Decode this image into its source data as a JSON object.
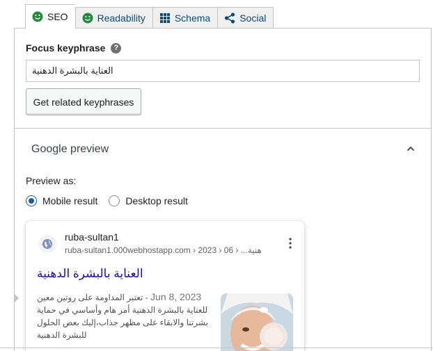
{
  "tabs": [
    {
      "label": "SEO",
      "icon": "smiley-icon",
      "active": true
    },
    {
      "label": "Readability",
      "icon": "smiley-icon",
      "active": false
    },
    {
      "label": "Schema",
      "icon": "grid-icon",
      "active": false
    },
    {
      "label": "Social",
      "icon": "share-icon",
      "active": false
    }
  ],
  "focus": {
    "label": "Focus keyphrase",
    "help": "?",
    "value": "العناية بالبشرة الدهنية",
    "button": "Get related keyphrases"
  },
  "google": {
    "title": "Google preview",
    "preview_as": "Preview as:",
    "options": [
      "Mobile result",
      "Desktop result"
    ],
    "selected": "Mobile result"
  },
  "result": {
    "site_name": "ruba-sultan1",
    "url": "ruba-sultan1.000webhostapp.com › 2023 › 06 › ...هنية",
    "title": "العناية بالبشرة الدهنية",
    "date": "Jun 8, 2023",
    "snippet": "تعتبر المداومة على روتين معين للعناية بالبشرة الدهنية أمر هام وأساسي في حماية بشرتنا والابقاء على مظهر جذاب،إليك بعض الحلول للبشرة الدهنية"
  },
  "colors": {
    "smiley": "#1e8c3a",
    "blue": "#0b4a7a",
    "link": "#1a0dab"
  }
}
